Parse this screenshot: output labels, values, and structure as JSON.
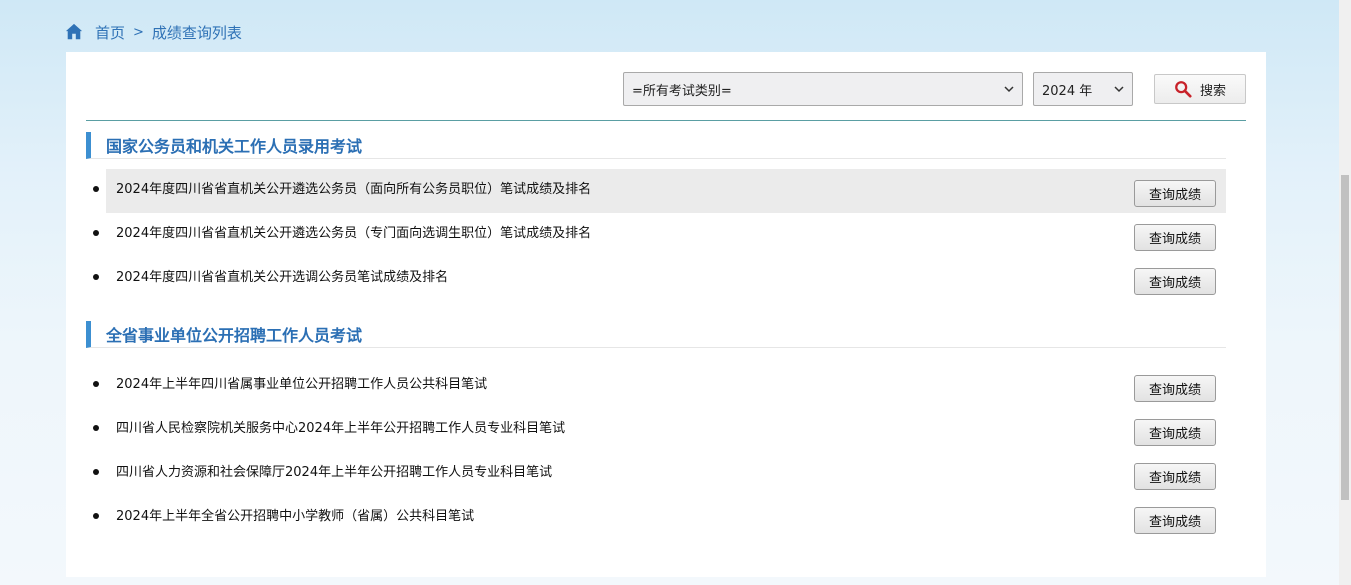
{
  "breadcrumb": {
    "home": "首页",
    "separator": ">",
    "current": "成绩查询列表"
  },
  "search": {
    "category_selected": "=所有考试类别=",
    "year_selected": "2024 年",
    "button_label": "搜索"
  },
  "sections": [
    {
      "title": "国家公务员和机关工作人员录用考试",
      "items": [
        {
          "title": "2024年度四川省省直机关公开遴选公务员（面向所有公务员职位）笔试成绩及排名",
          "button": "查询成绩"
        },
        {
          "title": "2024年度四川省省直机关公开遴选公务员（专门面向选调生职位）笔试成绩及排名",
          "button": "查询成绩"
        },
        {
          "title": "2024年度四川省省直机关公开选调公务员笔试成绩及排名",
          "button": "查询成绩"
        }
      ]
    },
    {
      "title": "全省事业单位公开招聘工作人员考试",
      "items": [
        {
          "title": "2024年上半年四川省属事业单位公开招聘工作人员公共科目笔试",
          "button": "查询成绩"
        },
        {
          "title": "四川省人民检察院机关服务中心2024年上半年公开招聘工作人员专业科目笔试",
          "button": "查询成绩"
        },
        {
          "title": "四川省人力资源和社会保障厅2024年上半年公开招聘工作人员专业科目笔试",
          "button": "查询成绩"
        },
        {
          "title": "2024年上半年全省公开招聘中小学教师（省属）公共科目笔试",
          "button": "查询成绩"
        }
      ]
    }
  ],
  "colors": {
    "accent": "#2f72b6",
    "section_bar": "#3c8fd1",
    "divider": "#5a9ea3",
    "highlight_row": "#ebebeb"
  },
  "icons": {
    "home": "home-icon",
    "search": "magnifier-icon",
    "chevron": "chevron-down-icon"
  }
}
